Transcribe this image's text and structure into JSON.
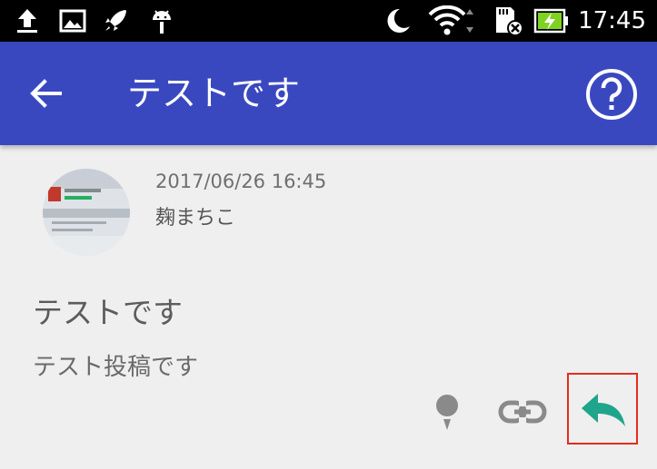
{
  "status_bar": {
    "time": "17:45",
    "icons": [
      "upload-icon",
      "image-icon",
      "rocket-icon",
      "android-icon",
      "moon-icon",
      "wifi-icon",
      "sd-card-icon",
      "battery-charging-icon"
    ]
  },
  "app_bar": {
    "title": "テストです",
    "back_icon": "arrow-back-icon",
    "help_icon": "help-icon",
    "color": "#3a48c0"
  },
  "post": {
    "date": "2017/06/26 16:45",
    "author": "麹まちこ",
    "title": "テストです",
    "body": "テスト投稿です"
  },
  "actions": {
    "pin_icon": "pin-icon",
    "link_icon": "link-icon",
    "reply_icon": "reply-icon",
    "reply_color": "#1fa58c",
    "highlight_color": "#e52b1e"
  }
}
